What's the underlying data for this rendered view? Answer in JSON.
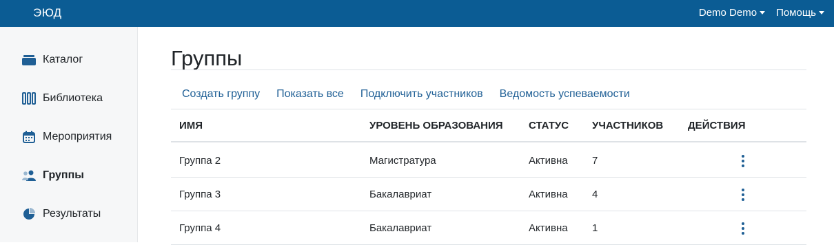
{
  "topbar": {
    "logo": "ЭЮД",
    "user_menu": "Demo Demo",
    "help_menu": "Помощь"
  },
  "sidebar": {
    "items": [
      {
        "label": "Каталог",
        "icon": "catalog-icon"
      },
      {
        "label": "Библиотека",
        "icon": "library-icon"
      },
      {
        "label": "Мероприятия",
        "icon": "calendar-icon"
      },
      {
        "label": "Группы",
        "icon": "users-icon",
        "active": true
      },
      {
        "label": "Результаты",
        "icon": "pie-chart-icon"
      }
    ]
  },
  "main": {
    "title": "Группы",
    "actions": [
      "Создать группу",
      "Показать все",
      "Подключить участников",
      "Ведомость успеваемости"
    ],
    "table": {
      "headers": [
        "ИМЯ",
        "УРОВЕНЬ ОБРАЗОВАНИЯ",
        "СТАТУС",
        "УЧАСТНИКОВ",
        "ДЕЙСТВИЯ"
      ],
      "rows": [
        [
          "Группа 2",
          "Магистратура",
          "Активна",
          "7"
        ],
        [
          "Группа 3",
          "Бакалавриат",
          "Активна",
          "4"
        ],
        [
          "Группа 4",
          "Бакалавриат",
          "Активна",
          "1"
        ]
      ]
    }
  },
  "colors": {
    "topbar": "#0b5c94",
    "link": "#1f5f95",
    "icon": "#1f5f95"
  }
}
